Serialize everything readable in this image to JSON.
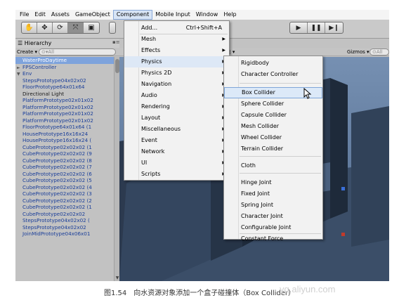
{
  "menubar": [
    "File",
    "Edit",
    "Assets",
    "GameObject",
    "Component",
    "Mobile Input",
    "Window",
    "Help"
  ],
  "hierarchy": {
    "title": "Hierarchy",
    "create_label": "Create",
    "search_placeholder": "All",
    "items": [
      {
        "text": "WaterProDaytime",
        "level": 0,
        "selected": true
      },
      {
        "text": "FPSController",
        "level": 0,
        "arrow": "►"
      },
      {
        "text": "Env",
        "level": 0,
        "arrow": "▼"
      },
      {
        "text": "StepsPrototype04x02x02",
        "level": 1
      },
      {
        "text": "FloorPrototype64x01x64",
        "level": 1
      },
      {
        "text": "Directional Light",
        "level": 1,
        "plain": true
      },
      {
        "text": "PlatformPrototype02x01x02",
        "level": 1
      },
      {
        "text": "PlatformPrototype02x01x02",
        "level": 1
      },
      {
        "text": "PlatformPrototype02x01x02",
        "level": 1
      },
      {
        "text": "PlatformPrototype02x01x02",
        "level": 1
      },
      {
        "text": "FloorPrototype64x01x64 (1",
        "level": 1
      },
      {
        "text": "HousePrototype16x16x24",
        "level": 1
      },
      {
        "text": "HousePrototype16x16x24 (",
        "level": 1
      },
      {
        "text": "CubePrototype02x02x02 (1",
        "level": 1
      },
      {
        "text": "CubePrototype02x02x02 (9",
        "level": 1
      },
      {
        "text": "CubePrototype02x02x02 (8",
        "level": 1
      },
      {
        "text": "CubePrototype02x02x02 (7",
        "level": 1
      },
      {
        "text": "CubePrototype02x02x02 (6",
        "level": 1
      },
      {
        "text": "CubePrototype02x02x02 (5",
        "level": 1
      },
      {
        "text": "CubePrototype02x02x02 (4",
        "level": 1
      },
      {
        "text": "CubePrototype02x02x02 (3",
        "level": 1
      },
      {
        "text": "CubePrototype02x02x02 (2",
        "level": 1
      },
      {
        "text": "CubePrototype02x02x02 (1",
        "level": 1
      },
      {
        "text": "CubePrototype02x02x02",
        "level": 1
      },
      {
        "text": "StepsPrototype04x02x02 (",
        "level": 1
      },
      {
        "text": "StepsPrototype04x02x02",
        "level": 1
      },
      {
        "text": "JoinMidPrototype04x06x01",
        "level": 1
      }
    ]
  },
  "scene": {
    "gizmos_label": "Gizmos",
    "search_placeholder": "All"
  },
  "component_menu": {
    "items": [
      {
        "label": "Add...",
        "shortcut": "Ctrl+Shift+A"
      },
      {
        "label": "Mesh",
        "submenu": true
      },
      {
        "label": "Effects",
        "submenu": true
      },
      {
        "label": "Physics",
        "submenu": true,
        "highlight": true
      },
      {
        "label": "Physics 2D",
        "submenu": true
      },
      {
        "label": "Navigation",
        "submenu": true
      },
      {
        "label": "Audio",
        "submenu": true
      },
      {
        "label": "Rendering",
        "submenu": true
      },
      {
        "label": "Layout",
        "submenu": true
      },
      {
        "label": "Miscellaneous",
        "submenu": true
      },
      {
        "label": "Event",
        "submenu": true
      },
      {
        "label": "Network",
        "submenu": true
      },
      {
        "label": "UI",
        "submenu": true
      },
      {
        "label": "Scripts",
        "submenu": true
      }
    ]
  },
  "physics_menu": {
    "items": [
      {
        "label": "Rigidbody"
      },
      {
        "label": "Character Controller"
      },
      {
        "label": "Box Collider",
        "highlight": true
      },
      {
        "label": "Sphere Collider"
      },
      {
        "label": "Capsule Collider"
      },
      {
        "label": "Mesh Collider"
      },
      {
        "label": "Wheel Collider"
      },
      {
        "label": "Terrain Collider"
      },
      {
        "label": "Cloth"
      },
      {
        "label": "Hinge Joint"
      },
      {
        "label": "Fixed Joint"
      },
      {
        "label": "Spring Joint"
      },
      {
        "label": "Character Joint"
      },
      {
        "label": "Configurable Joint"
      },
      {
        "label": "Constant Force"
      }
    ]
  },
  "caption": "图1.54　向水资源对象添加一个盒子碰撞体（Box Collider）",
  "watermark": "yq.aliyun.com",
  "colors": {
    "menu_highlight": "#dde8f6",
    "selection": "#7ea3dc",
    "hierarchy_text": "#1b3f9a",
    "scene_sky": "#5b7699",
    "building": "#2f3d52"
  },
  "icons": [
    "hand-icon",
    "move-icon",
    "rotate-icon",
    "scale-icon",
    "rect-icon",
    "play-icon",
    "pause-icon",
    "step-icon",
    "lock-icon",
    "cursor-arrow-icon"
  ]
}
